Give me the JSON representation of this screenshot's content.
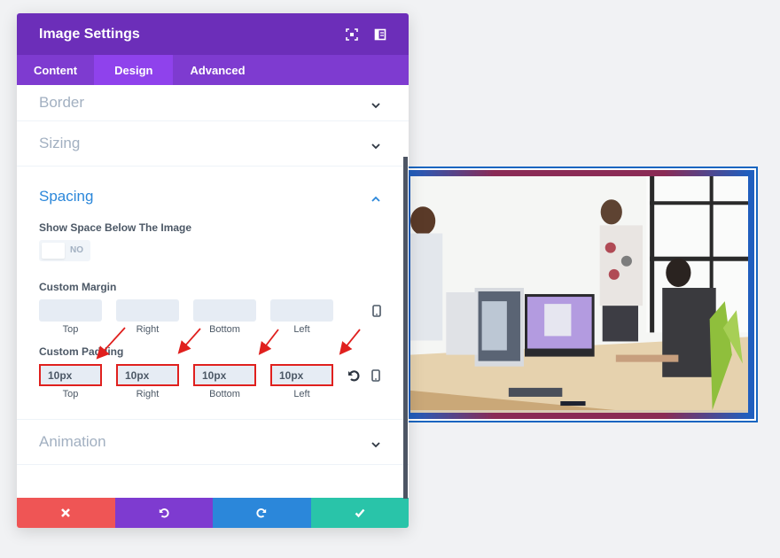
{
  "modal": {
    "title": "Image Settings",
    "header_icons": [
      "fullscreen-icon",
      "sidebar-toggle-icon"
    ],
    "tabs": [
      {
        "label": "Content",
        "active": false
      },
      {
        "label": "Design",
        "active": true
      },
      {
        "label": "Advanced",
        "active": false
      }
    ]
  },
  "sections": {
    "border": {
      "title": "Border",
      "expanded": false
    },
    "sizing": {
      "title": "Sizing",
      "expanded": false
    },
    "spacing": {
      "title": "Spacing",
      "expanded": true
    },
    "animation": {
      "title": "Animation",
      "expanded": false
    }
  },
  "spacing": {
    "show_space_label": "Show Space Below The Image",
    "show_space_value": "NO",
    "custom_margin": {
      "label": "Custom Margin",
      "fields": [
        {
          "label": "Top",
          "value": ""
        },
        {
          "label": "Right",
          "value": ""
        },
        {
          "label": "Bottom",
          "value": ""
        },
        {
          "label": "Left",
          "value": ""
        }
      ]
    },
    "custom_padding": {
      "label": "Custom Padding",
      "fields": [
        {
          "label": "Top",
          "value": "10px"
        },
        {
          "label": "Right",
          "value": "10px"
        },
        {
          "label": "Bottom",
          "value": "10px"
        },
        {
          "label": "Left",
          "value": "10px"
        }
      ]
    }
  },
  "footer": {
    "buttons": [
      {
        "name": "cancel",
        "icon": "close-icon",
        "color": "#ef5555"
      },
      {
        "name": "undo",
        "icon": "undo-icon",
        "color": "#7e3bd0"
      },
      {
        "name": "redo",
        "icon": "redo-icon",
        "color": "#2b87da"
      },
      {
        "name": "save",
        "icon": "check-icon",
        "color": "#29c4a9"
      }
    ]
  },
  "colors": {
    "header": "#6c2eb9",
    "tabs": "#7e3bd0",
    "active_tab": "#8f42ec",
    "open_section": "#2b87da",
    "highlight": "#e0201e"
  },
  "preview": {
    "alt": "Three men working at desks with desktop computers in a bright office"
  }
}
